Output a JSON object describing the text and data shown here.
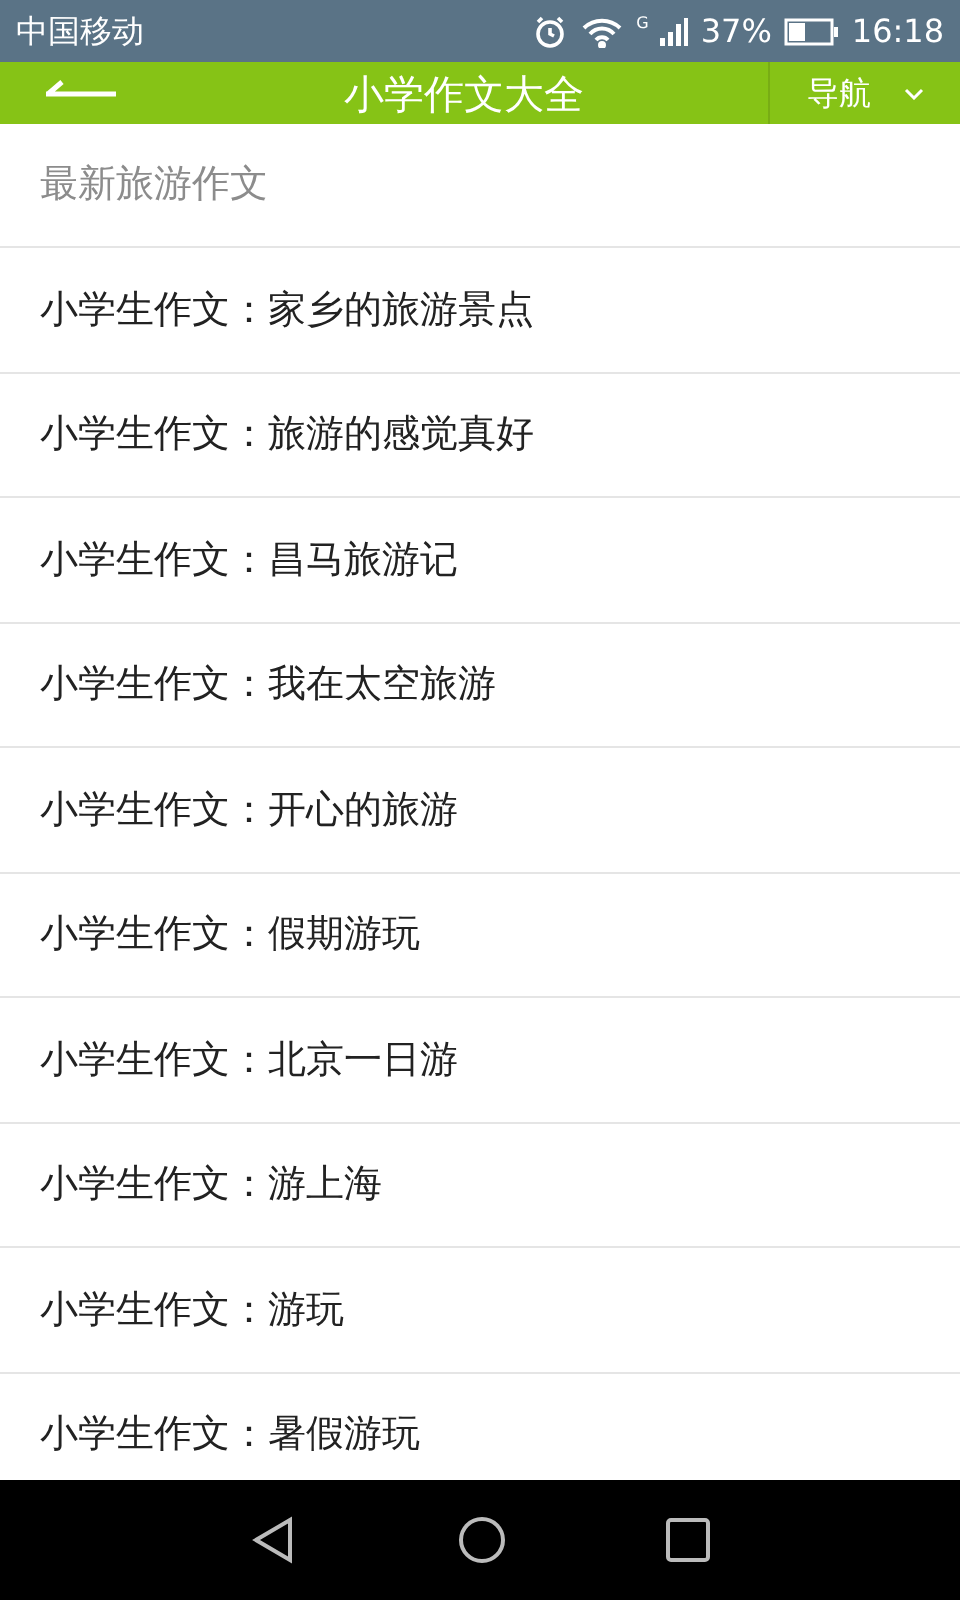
{
  "status_bar": {
    "carrier": "中国移动",
    "battery": "37%",
    "time": "16:18",
    "network": "G"
  },
  "header": {
    "title": "小学作文大全",
    "nav_button": "导航"
  },
  "section_title": "最新旅游作文",
  "articles": [
    {
      "title": "小学生作文：家乡的旅游景点"
    },
    {
      "title": "小学生作文：旅游的感觉真好"
    },
    {
      "title": "小学生作文：昌马旅游记"
    },
    {
      "title": "小学生作文：我在太空旅游"
    },
    {
      "title": "小学生作文：开心的旅游"
    },
    {
      "title": "小学生作文：假期游玩"
    },
    {
      "title": "小学生作文：北京一日游"
    },
    {
      "title": "小学生作文：游上海"
    },
    {
      "title": "小学生作文：游玩"
    },
    {
      "title": "小学生作文：暑假游玩"
    }
  ]
}
